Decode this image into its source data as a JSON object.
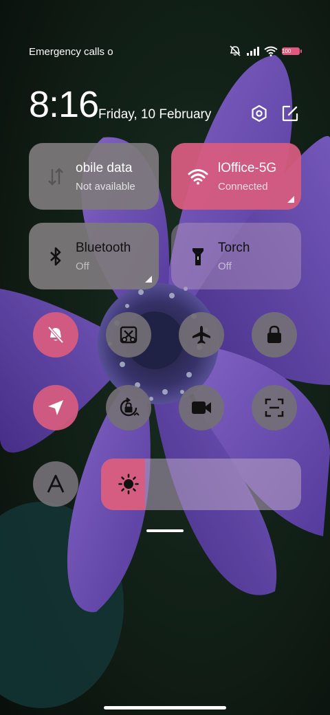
{
  "status_bar": {
    "carrier": "Emergency calls o",
    "battery": "100",
    "icons": [
      "silent-icon",
      "signal-icon",
      "wifi-icon",
      "battery-icon"
    ]
  },
  "header": {
    "time": "8:16",
    "date": "Friday, 10 February",
    "icons": [
      "settings-icon",
      "edit-icon"
    ]
  },
  "tiles": {
    "mobile_data": {
      "title": "obile data",
      "subtitle": "Not available",
      "state": "unavailable"
    },
    "wifi": {
      "title": "lOffice-5G",
      "subtitle": "Connected",
      "state": "on"
    },
    "bluetooth": {
      "title": "Bluetooth",
      "subtitle": "Off",
      "state": "off"
    },
    "torch": {
      "title": "Torch",
      "subtitle": "Off",
      "state": "off"
    }
  },
  "toggles": [
    {
      "name": "silent",
      "icon": "bell-off-icon",
      "state": "on"
    },
    {
      "name": "screenshot",
      "icon": "scissors-icon",
      "state": "off"
    },
    {
      "name": "airplane-mode",
      "icon": "airplane-icon",
      "state": "off"
    },
    {
      "name": "lock-screen",
      "icon": "lock-icon",
      "state": "off"
    },
    {
      "name": "location",
      "icon": "location-icon",
      "state": "on"
    },
    {
      "name": "rotation-lock",
      "icon": "rotation-lock-icon",
      "state": "off"
    },
    {
      "name": "screen-recorder",
      "icon": "video-camera-icon",
      "state": "off"
    },
    {
      "name": "scanner",
      "icon": "scan-icon",
      "state": "off"
    },
    {
      "name": "font",
      "icon": "letter-a-icon",
      "state": "off"
    }
  ],
  "brightness": {
    "level": 0.22,
    "icon": "sun-icon"
  },
  "colors": {
    "accent": "#d65c7f",
    "tile_off": "#7e7a7d"
  }
}
